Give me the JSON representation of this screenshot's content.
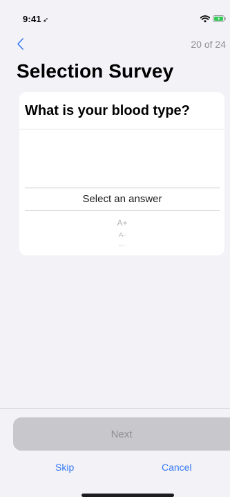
{
  "status_bar": {
    "time": "9:41",
    "location_glyph": "➶"
  },
  "nav": {
    "back_icon": "chevron-left-icon",
    "progress": "20 of 24"
  },
  "page": {
    "title": "Selection Survey"
  },
  "question": {
    "text": "What is your blood type?",
    "picker": {
      "selected_label": "Select an answer",
      "visible_options": [
        "A+",
        "A-",
        "B+"
      ]
    }
  },
  "footer": {
    "next_label": "Next",
    "skip_label": "Skip",
    "cancel_label": "Cancel"
  },
  "colors": {
    "accent": "#3478f6",
    "background": "#f2f2f7",
    "disabled_button": "#c7c7cc"
  }
}
